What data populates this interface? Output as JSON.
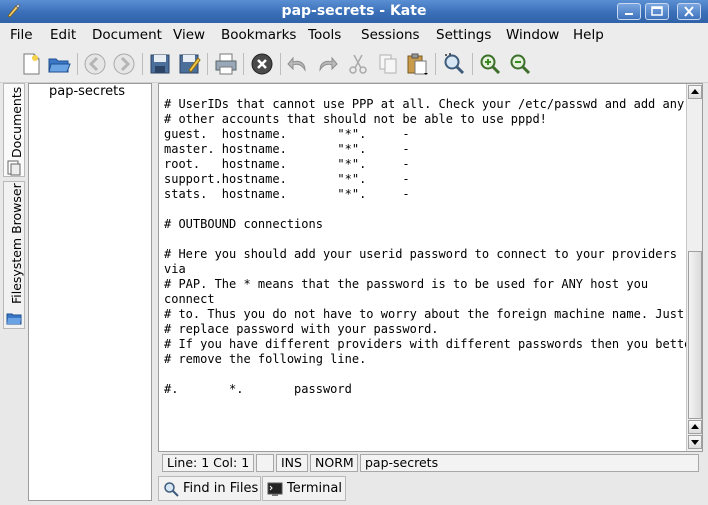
{
  "window": {
    "title": "pap-secrets - Kate"
  },
  "menu": [
    "File",
    "Edit",
    "Document",
    "View",
    "Bookmarks",
    "Tools",
    "Sessions",
    "Settings",
    "Window",
    "Help"
  ],
  "toolbar": {
    "icons": [
      "new-file-icon",
      "open-file-icon",
      "back-icon",
      "forward-icon",
      "save-icon",
      "save-as-icon",
      "print-icon",
      "close-document-icon",
      "undo-icon",
      "redo-icon",
      "cut-icon",
      "copy-icon",
      "paste-icon",
      "find-icon",
      "zoom-in-icon",
      "zoom-out-icon"
    ]
  },
  "sidebar": {
    "tabs": [
      "Documents",
      "Filesystem Browser"
    ],
    "documents": [
      "pap-secrets"
    ]
  },
  "editor": {
    "lines": [
      "# UserIDs that cannot use PPP at all. Check your /etc/passwd and add any",
      "# other accounts that should not be able to use pppd!",
      "guest\u001f  hostname\u001f       \"*\"\u001f     -",
      "master\u001f hostname\u001f       \"*\"\u001f     -",
      "root\u001f   hostname\u001f       \"*\"\u001f     -",
      "support\u001fhostname\u001f       \"*\"\u001f     -",
      "stats\u001f  hostname\u001f       \"*\"\u001f     -",
      "",
      "# OUTBOUND connections",
      "",
      "# Here you should add your userid password to connect to your providers",
      "via",
      "# PAP. The * means that the password is to be used for ANY host you",
      "connect",
      "# to. Thus you do not have to worry about the foreign machine name. Just",
      "# replace password with your password.",
      "# If you have different providers with different passwords then you better",
      "# remove the following line.",
      "",
      "#\u001f       *\u001f       password"
    ]
  },
  "status": {
    "position": "Line: 1 Col: 1",
    "modified": "",
    "insert_mode": "INS",
    "selection_mode": "NORM",
    "filename": "pap-secrets"
  },
  "bottom_tabs": [
    "Find in Files",
    "Terminal"
  ]
}
